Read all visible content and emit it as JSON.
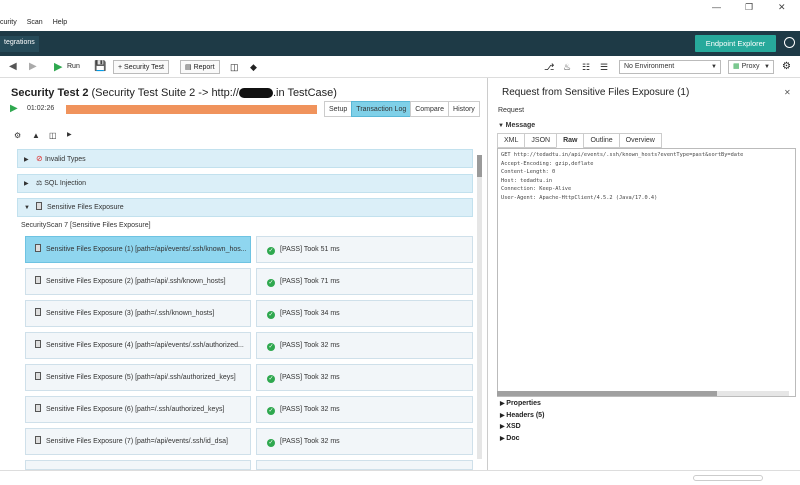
{
  "menu": [
    "curity",
    "Scan",
    "Help"
  ],
  "nav": {
    "tab": "tegrations",
    "endpoint_explorer": "Endpoint Explorer"
  },
  "toolbar": {
    "run": "Run",
    "security_test": "Security Test",
    "report": "Report",
    "environment": "No Environment",
    "proxy": "Proxy"
  },
  "testcase": {
    "title_prefix": "Security Test 2",
    "title_mid": " (Security Test Suite 2 -> http://",
    "title_suffix": ".in TestCase)",
    "time": "01:02:26",
    "tabs": [
      "Setup",
      "Transaction Log",
      "Compare",
      "History"
    ],
    "active_tab": "Transaction Log"
  },
  "sections": [
    {
      "label": "Invalid Types"
    },
    {
      "label": "SQL Injection"
    },
    {
      "label": "Sensitive Files Exposure"
    }
  ],
  "scan_label": "SecurityScan 7 [Sensitive Files Exposure]",
  "steps": [
    {
      "name": "Sensitive Files Exposure (1) [path=/api/events/.ssh/known_hos...",
      "result": "[PASS] Took 51 ms"
    },
    {
      "name": "Sensitive Files Exposure (2) [path=/api/.ssh/known_hosts]",
      "result": "[PASS] Took 71 ms"
    },
    {
      "name": "Sensitive Files Exposure (3) [path=/.ssh/known_hosts]",
      "result": "[PASS] Took 34 ms"
    },
    {
      "name": "Sensitive Files Exposure (4) [path=/api/events/.ssh/authorized...",
      "result": "[PASS] Took 32 ms"
    },
    {
      "name": "Sensitive Files Exposure (5) [path=/api/.ssh/authorized_keys]",
      "result": "[PASS] Took 32 ms"
    },
    {
      "name": "Sensitive Files Exposure (6) [path=/.ssh/authorized_keys]",
      "result": "[PASS] Took 32 ms"
    },
    {
      "name": "Sensitive Files Exposure (7) [path=/api/events/.ssh/id_dsa]",
      "result": "[PASS] Took 32 ms"
    }
  ],
  "right": {
    "title": "Request from Sensitive Files Exposure (1)",
    "request_label": "Request",
    "message_label": "Message",
    "tabs": [
      "XML",
      "JSON",
      "Raw",
      "Outline",
      "Overview"
    ],
    "active_tab": "Raw",
    "raw": "GET http://tedadtu.in/api/events/.ssh/known_hosts?eventType=past&sortBy=date\nAccept-Encoding: gzip,deflate\nContent-Length: 0\nHost: tedadtu.in\nConnection: Keep-Alive\nUser-Agent: Apache-HttpClient/4.5.2 (Java/17.0.4)",
    "props": [
      "Properties",
      "Headers (5)",
      "XSD",
      "Doc"
    ]
  }
}
